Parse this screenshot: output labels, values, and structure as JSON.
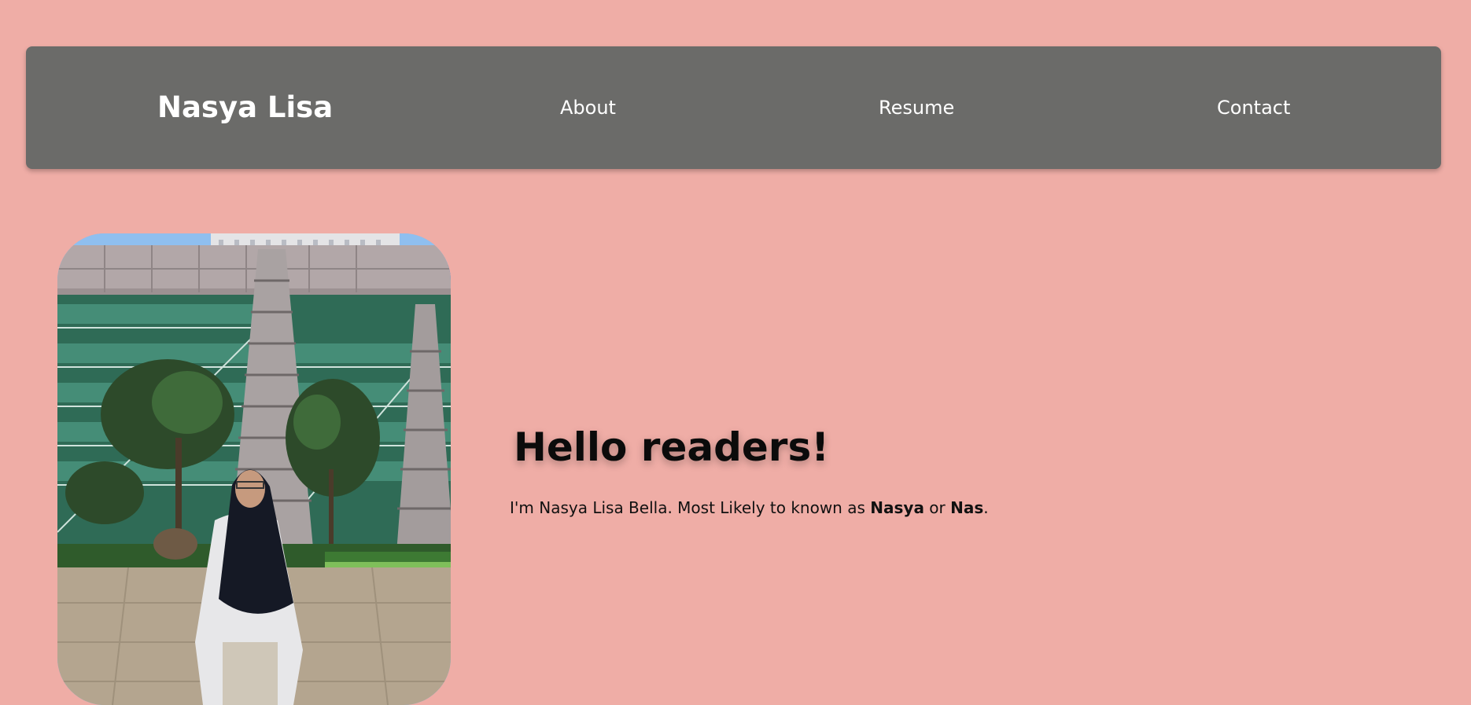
{
  "navbar": {
    "brand": "Nasya Lisa",
    "links": [
      "About",
      "Resume",
      "Contact"
    ],
    "background_color": "#6b6b69"
  },
  "hero": {
    "photo_alt": "photo-of-nasya",
    "heading": "Hello readers!",
    "intro_prefix": "I'm Nasya Lisa Bella. Most Likely to known as ",
    "nickname_1": "Nasya",
    "intro_middle": " or ",
    "nickname_2": "Nas",
    "intro_suffix": "."
  },
  "colors": {
    "page_background": "#efada6",
    "text": "#111111",
    "nav_text": "#ffffff"
  }
}
